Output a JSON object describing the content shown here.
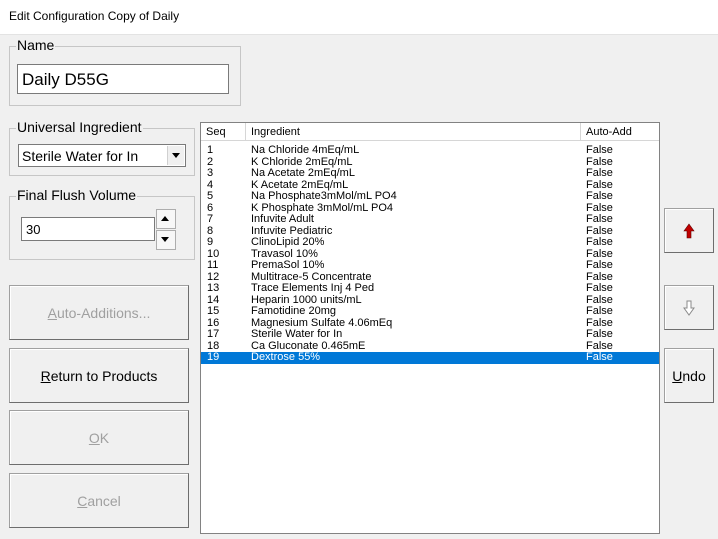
{
  "window": {
    "title": "Edit Configuration Copy of Daily"
  },
  "name_group": {
    "label": "Name",
    "value": "Daily D55G"
  },
  "universal_ingredient": {
    "label": "Universal Ingredient",
    "selected": "Sterile Water for In"
  },
  "final_flush": {
    "label": "Final Flush Volume",
    "value": "30"
  },
  "buttons": {
    "auto_additions": "Auto-Additions...",
    "return_to_products": "Return to Products",
    "ok": "OK",
    "cancel": "Cancel",
    "undo": "Undo"
  },
  "list": {
    "columns": [
      "Seq",
      "Ingredient",
      "Auto-Add"
    ],
    "selected_index": 18,
    "rows": [
      {
        "seq": "1",
        "ingredient": "Na Chloride 4mEq/mL",
        "auto_add": "False"
      },
      {
        "seq": "2",
        "ingredient": "K Chloride 2mEq/mL",
        "auto_add": "False"
      },
      {
        "seq": "3",
        "ingredient": "Na Acetate 2mEq/mL",
        "auto_add": "False"
      },
      {
        "seq": "4",
        "ingredient": "K Acetate 2mEq/mL",
        "auto_add": "False"
      },
      {
        "seq": "5",
        "ingredient": "Na Phosphate3mMol/mL PO4",
        "auto_add": "False"
      },
      {
        "seq": "6",
        "ingredient": "K Phosphate 3mMol/mL PO4",
        "auto_add": "False"
      },
      {
        "seq": "7",
        "ingredient": "Infuvite Adult",
        "auto_add": "False"
      },
      {
        "seq": "8",
        "ingredient": "Infuvite Pediatric",
        "auto_add": "False"
      },
      {
        "seq": "9",
        "ingredient": "ClinoLipid 20%",
        "auto_add": "False"
      },
      {
        "seq": "10",
        "ingredient": "Travasol 10%",
        "auto_add": "False"
      },
      {
        "seq": "11",
        "ingredient": "PremaSol 10%",
        "auto_add": "False"
      },
      {
        "seq": "12",
        "ingredient": "Multitrace-5 Concentrate",
        "auto_add": "False"
      },
      {
        "seq": "13",
        "ingredient": "Trace Elements Inj 4 Ped",
        "auto_add": "False"
      },
      {
        "seq": "14",
        "ingredient": "Heparin 1000 units/mL",
        "auto_add": "False"
      },
      {
        "seq": "15",
        "ingredient": "Famotidine 20mg",
        "auto_add": "False"
      },
      {
        "seq": "16",
        "ingredient": "Magnesium Sulfate 4.06mEq",
        "auto_add": "False"
      },
      {
        "seq": "17",
        "ingredient": "Sterile Water for In",
        "auto_add": "False"
      },
      {
        "seq": "18",
        "ingredient": "Ca Gluconate 0.465mE",
        "auto_add": "False"
      },
      {
        "seq": "19",
        "ingredient": "Dextrose 55%",
        "auto_add": "False"
      }
    ]
  },
  "colors": {
    "selection": "#0078d7",
    "move_up_arrow": "#c00000",
    "disabled_text": "#a0a0a0"
  },
  "icons": {
    "move_up": "red-up-arrow-icon",
    "move_down": "gray-down-arrow-icon"
  }
}
